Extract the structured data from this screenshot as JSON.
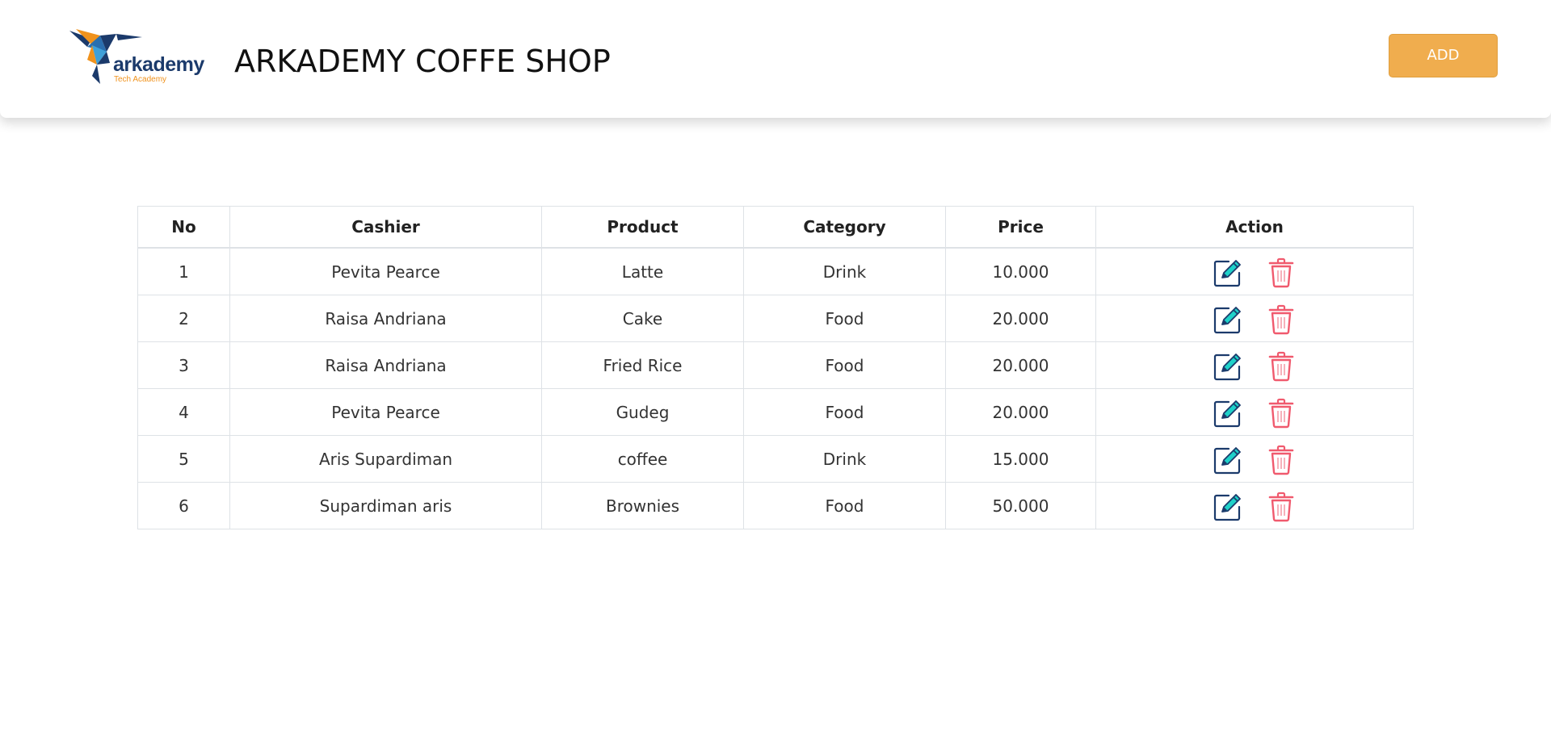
{
  "header": {
    "logo": {
      "word": "arkademy",
      "sub": "Tech Academy"
    },
    "title": "ARKADEMY COFFE SHOP",
    "add_label": "ADD"
  },
  "colors": {
    "add_button": "#f0ad4e",
    "edit_icon": "#1fd1c9",
    "delete_icon": "#f05a6e",
    "logo_text": "#1b3a6b",
    "logo_accent": "#f0921c"
  },
  "icons": {
    "edit": "edit-pencil-icon",
    "delete": "trash-icon"
  },
  "table": {
    "columns": [
      "No",
      "Cashier",
      "Product",
      "Category",
      "Price",
      "Action"
    ],
    "rows": [
      {
        "no": "1",
        "cashier": "Pevita Pearce",
        "product": "Latte",
        "category": "Drink",
        "price": "10.000"
      },
      {
        "no": "2",
        "cashier": "Raisa Andriana",
        "product": "Cake",
        "category": "Food",
        "price": "20.000"
      },
      {
        "no": "3",
        "cashier": "Raisa Andriana",
        "product": "Fried Rice",
        "category": "Food",
        "price": "20.000"
      },
      {
        "no": "4",
        "cashier": "Pevita Pearce",
        "product": "Gudeg",
        "category": "Food",
        "price": "20.000"
      },
      {
        "no": "5",
        "cashier": "Aris Supardiman",
        "product": "coffee",
        "category": "Drink",
        "price": "15.000"
      },
      {
        "no": "6",
        "cashier": "Supardiman aris",
        "product": "Brownies",
        "category": "Food",
        "price": "50.000"
      }
    ]
  }
}
